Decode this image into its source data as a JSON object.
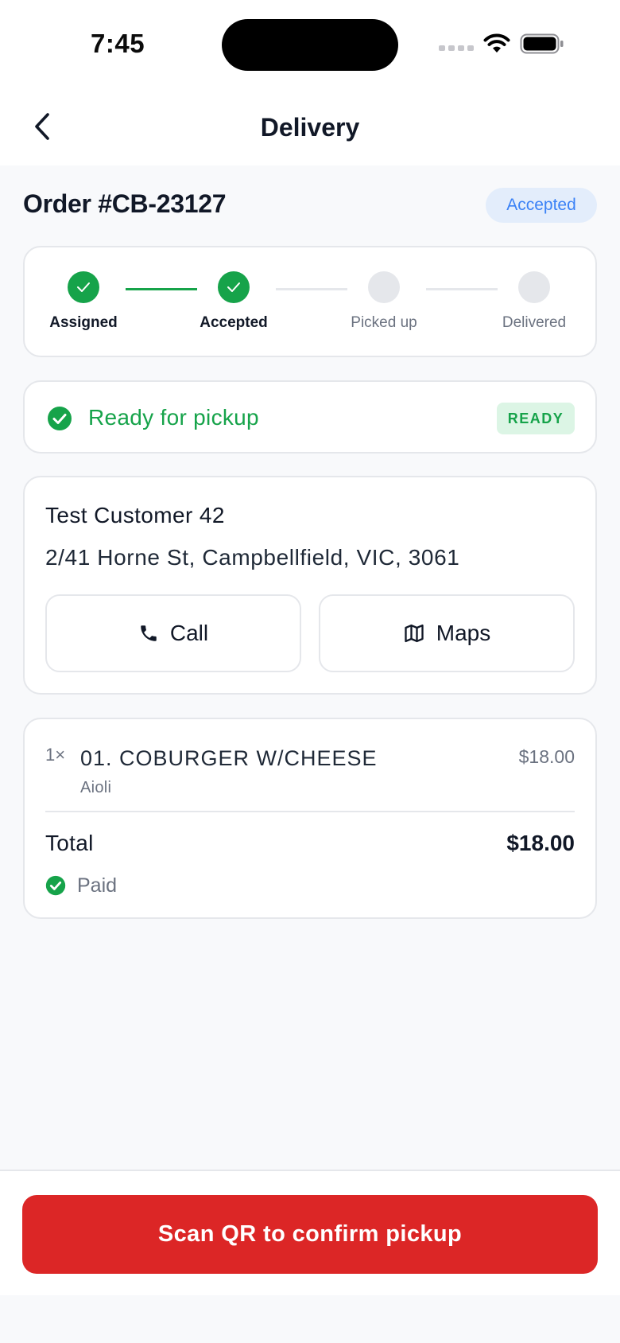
{
  "status_bar": {
    "time": "7:45"
  },
  "nav": {
    "title": "Delivery"
  },
  "order": {
    "title": "Order #CB-23127",
    "status": "Accepted"
  },
  "steps": [
    {
      "label": "Assigned",
      "state": "done"
    },
    {
      "label": "Accepted",
      "state": "done"
    },
    {
      "label": "Picked up",
      "state": "todo"
    },
    {
      "label": "Delivered",
      "state": "todo"
    }
  ],
  "ready": {
    "text": "Ready for pickup",
    "badge": "READY"
  },
  "customer": {
    "name": "Test Customer 42",
    "address": "2/41 Horne St, Campbellfield, VIC, 3061",
    "call_label": "Call",
    "maps_label": "Maps"
  },
  "items": [
    {
      "qty": "1×",
      "name": "01. COBURGER W/CHEESE",
      "modifier": "Aioli",
      "price": "$18.00"
    }
  ],
  "totals": {
    "label": "Total",
    "value": "$18.00",
    "payment_status": "Paid"
  },
  "cta": {
    "label": "Scan QR to confirm pickup"
  },
  "colors": {
    "success": "#16a34a",
    "primary": "#dc2626",
    "accent_blue": "#3b82f6",
    "inactive": "#e5e7eb"
  }
}
